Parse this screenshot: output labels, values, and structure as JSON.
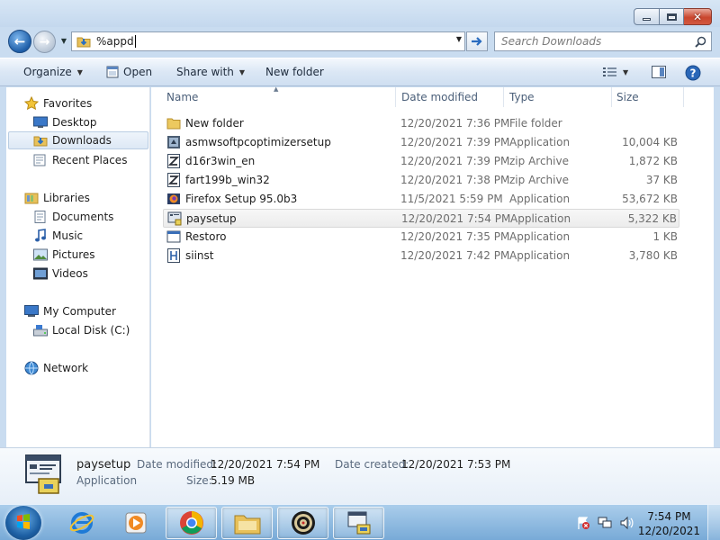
{
  "window": {
    "caption": {
      "minimize": "",
      "maximize": "",
      "close": "✕"
    }
  },
  "nav": {
    "address_text": "%appd",
    "search_placeholder": "Search Downloads"
  },
  "toolbar": {
    "organize": "Organize",
    "open": "Open",
    "share_with": "Share with",
    "new_folder": "New folder"
  },
  "sidebar": {
    "favorites": "Favorites",
    "desktop": "Desktop",
    "downloads": "Downloads",
    "recent_places": "Recent Places",
    "libraries": "Libraries",
    "documents": "Documents",
    "music": "Music",
    "pictures": "Pictures",
    "videos": "Videos",
    "my_computer": "My Computer",
    "local_disk": "Local Disk (C:)",
    "network": "Network"
  },
  "columns": {
    "name": "Name",
    "date_modified": "Date modified",
    "type": "Type",
    "size": "Size"
  },
  "files": [
    {
      "name": "New folder",
      "date": "12/20/2021 7:36 PM",
      "type": "File folder",
      "size": "",
      "icon": "folder-icon"
    },
    {
      "name": "asmwsoftpcoptimizersetup",
      "date": "12/20/2021 7:39 PM",
      "type": "Application",
      "size": "10,004 KB",
      "icon": "installer-icon"
    },
    {
      "name": "d16r3win_en",
      "date": "12/20/2021 7:39 PM",
      "type": "zip Archive",
      "size": "1,872 KB",
      "icon": "zip-icon"
    },
    {
      "name": "fart199b_win32",
      "date": "12/20/2021 7:38 PM",
      "type": "zip Archive",
      "size": "37 KB",
      "icon": "zip-icon"
    },
    {
      "name": "Firefox Setup 95.0b3",
      "date": "11/5/2021 5:59 PM",
      "type": "Application",
      "size": "53,672 KB",
      "icon": "firefox-icon"
    },
    {
      "name": "paysetup",
      "date": "12/20/2021 7:54 PM",
      "type": "Application",
      "size": "5,322 KB",
      "icon": "setup-icon"
    },
    {
      "name": "Restoro",
      "date": "12/20/2021 7:35 PM",
      "type": "Application",
      "size": "1 KB",
      "icon": "app-window-icon"
    },
    {
      "name": "siinst",
      "date": "12/20/2021 7:42 PM",
      "type": "Application",
      "size": "3,780 KB",
      "icon": "installer-icon"
    }
  ],
  "details": {
    "name": "paysetup",
    "type": "Application",
    "date_modified_label": "Date modified:",
    "date_modified": "12/20/2021 7:54 PM",
    "size_label": "Size:",
    "size": "5.19 MB",
    "date_created_label": "Date created:",
    "date_created": "12/20/2021 7:53 PM"
  },
  "taskbar": {
    "time": "7:54 PM",
    "date": "12/20/2021"
  }
}
